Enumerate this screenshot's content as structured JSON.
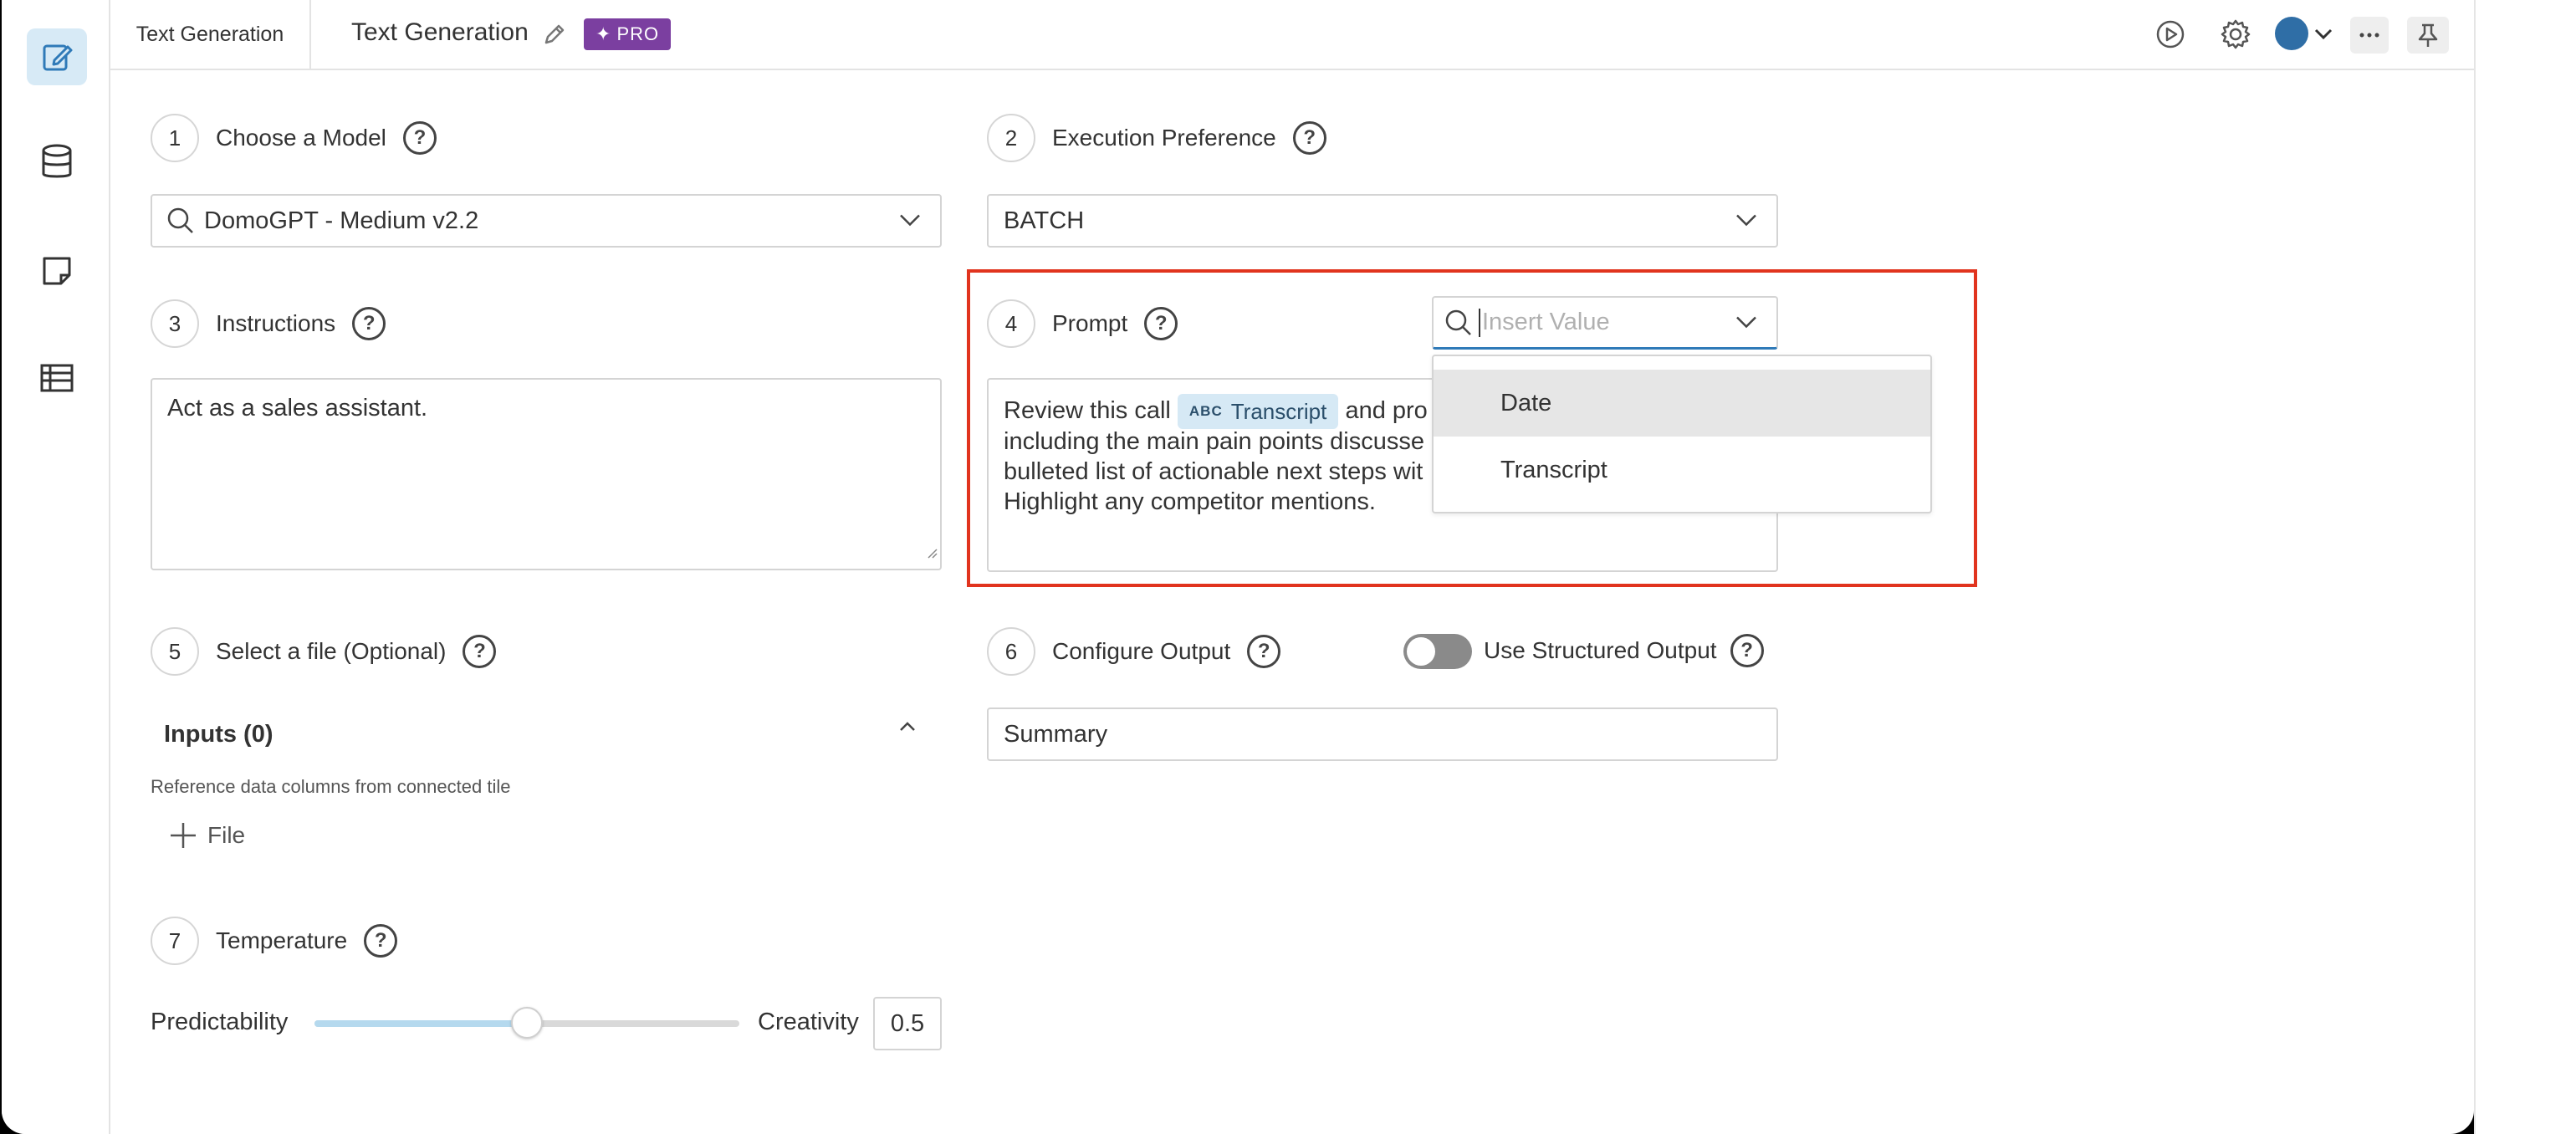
{
  "header": {
    "tab_label": "Text Generation",
    "title": "Text Generation",
    "pro_badge": "PRO"
  },
  "rail": {
    "items": [
      "edit-icon",
      "database-icon",
      "note-icon",
      "table-icon"
    ]
  },
  "steps": {
    "model": {
      "num": "1",
      "label": "Choose a Model",
      "value": "DomoGPT - Medium v2.2"
    },
    "execution": {
      "num": "2",
      "label": "Execution Preference",
      "value": "BATCH"
    },
    "instructions": {
      "num": "3",
      "label": "Instructions",
      "value": "Act as a sales assistant."
    },
    "prompt": {
      "num": "4",
      "label": "Prompt",
      "insert_placeholder": "Insert Value",
      "text_before_chip": "Review this call",
      "chip_type": "ABC",
      "chip_label": "Transcript",
      "text_after_chip": "and pro",
      "line2": "including the main pain points discusse",
      "line3": "bulleted list of actionable next steps wit",
      "line4": "Highlight any competitor mentions."
    },
    "file": {
      "num": "5",
      "label": "Select a file (Optional)",
      "inputs_title": "Inputs (0)",
      "inputs_desc": "Reference data columns from connected tile",
      "add_file": "File"
    },
    "output": {
      "num": "6",
      "label": "Configure Output",
      "structured_label": "Use Structured Output",
      "value": "Summary"
    },
    "temperature": {
      "num": "7",
      "label": "Temperature",
      "left_label": "Predictability",
      "right_label": "Creativity",
      "value": "0.5",
      "level": 0.5
    }
  },
  "dropdown": {
    "options": [
      "Date",
      "Transcript"
    ]
  },
  "colors": {
    "accent": "#2f6ea6",
    "highlight_border": "#e1341e",
    "pro": "#7b3fa0",
    "chip_bg": "#d6e9f5"
  }
}
